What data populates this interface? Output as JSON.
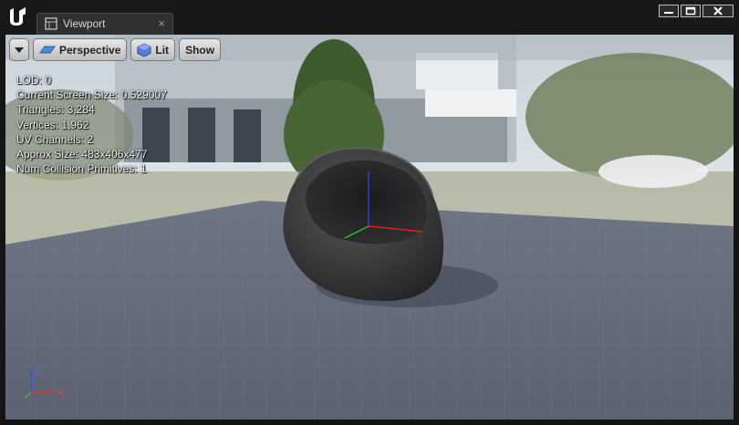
{
  "window": {
    "tab_label": "Viewport",
    "tab_close_icon": "×",
    "logo_icon": "unreal-logo-icon"
  },
  "toolbar": {
    "dropdown_icon": "chevron-down-icon",
    "perspective_label": "Perspective",
    "lit_label": "Lit",
    "show_label": "Show"
  },
  "stats": [
    {
      "label": "LOD:",
      "value": "0"
    },
    {
      "label": "Current Screen Size:",
      "value": "0.529007"
    },
    {
      "label": "Triangles:",
      "value": "3,284"
    },
    {
      "label": "Vertices:",
      "value": "1,962"
    },
    {
      "label": "UV Channels:",
      "value": "2"
    },
    {
      "label": "Approx Size:",
      "value": "483x406x477"
    },
    {
      "label": "Num Collision Primitives:",
      "value": "1"
    }
  ],
  "axis_gizmo": {
    "x_label": "X",
    "z_label": "Z",
    "colors": {
      "x": "#e03030",
      "y": "#30c030",
      "z": "#3050e0"
    }
  }
}
